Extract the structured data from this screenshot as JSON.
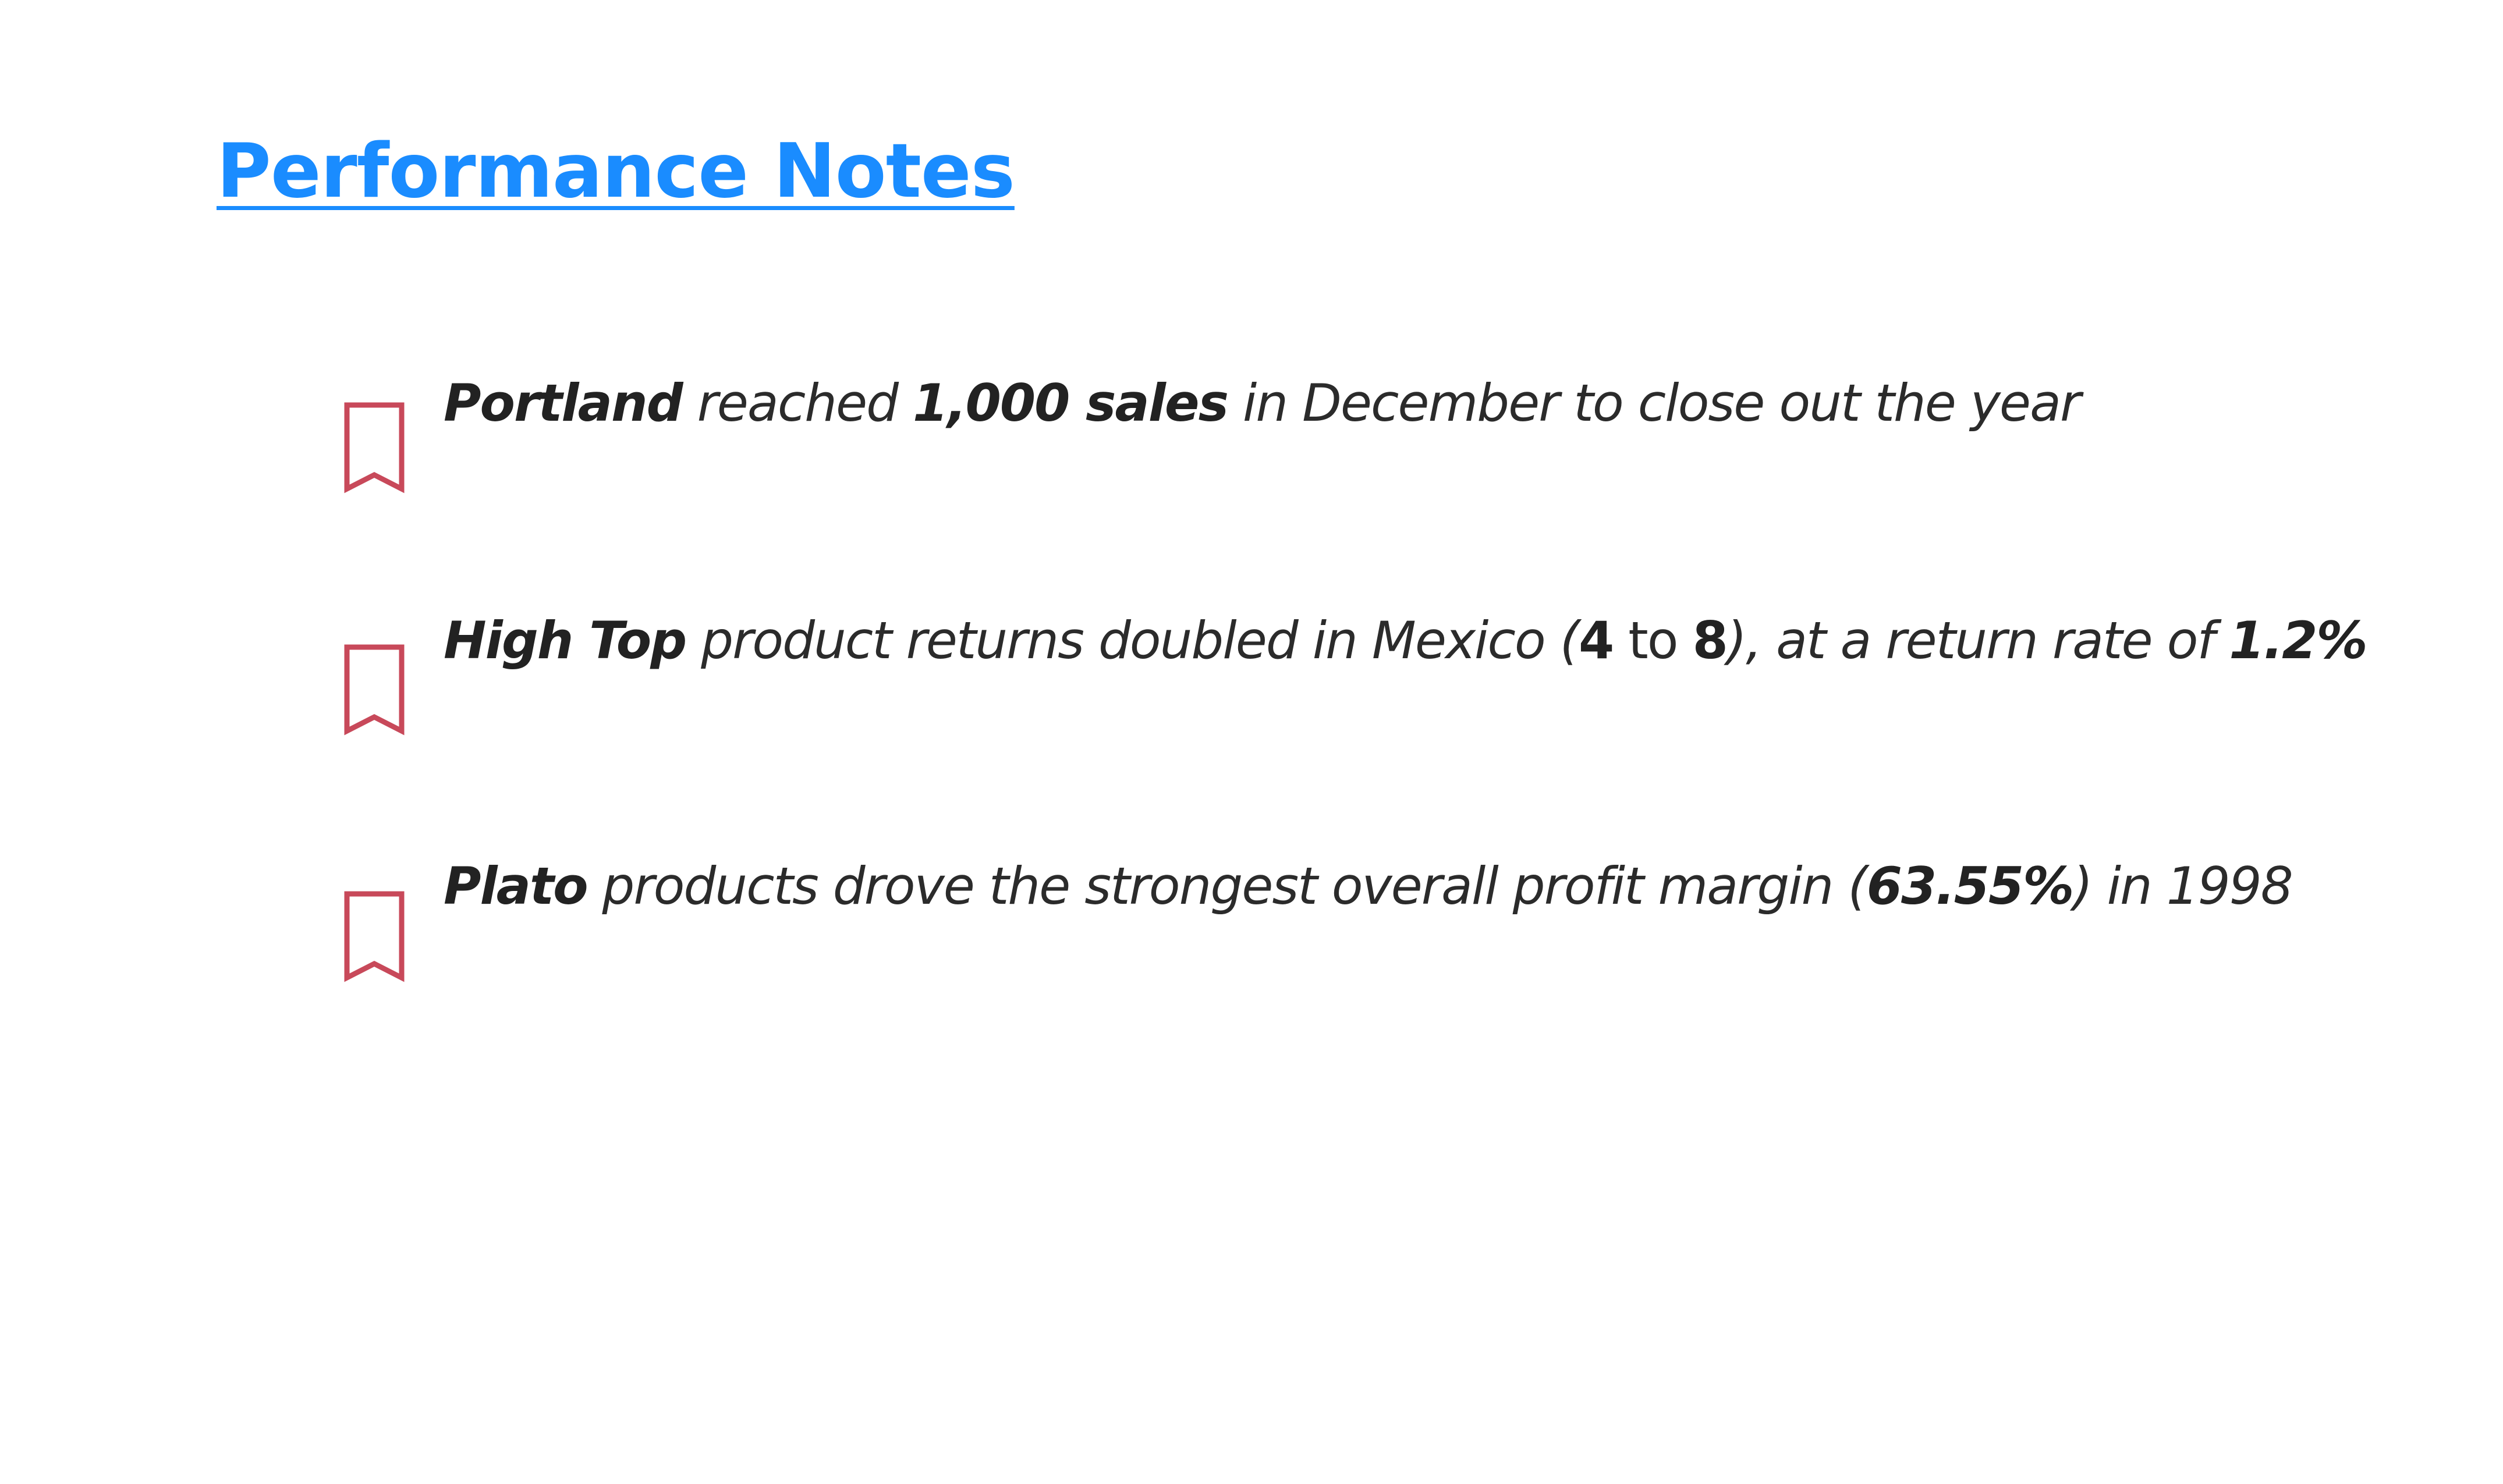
{
  "title": "Performance Notes",
  "accent_color": "#1a8cff",
  "bookmark_color": "#c8495a",
  "notes": [
    {
      "icon": "bookmark-icon",
      "subject": "Portland",
      "part1": " reached ",
      "metric": "1,000 sales",
      "part2": " in December to close out the year"
    },
    {
      "icon": "bookmark-icon",
      "subject": "High Top",
      "part1": " product returns doubled in Mexico (",
      "from_value": "4",
      "to_word": " to ",
      "to_value": "8",
      "part2": "), at a return rate of ",
      "rate": "1.2%"
    },
    {
      "icon": "bookmark-icon",
      "subject": "Plato",
      "part1": " products drove the strongest overall profit margin (",
      "margin": "63.55%",
      "part2": ") in 1998"
    }
  ]
}
